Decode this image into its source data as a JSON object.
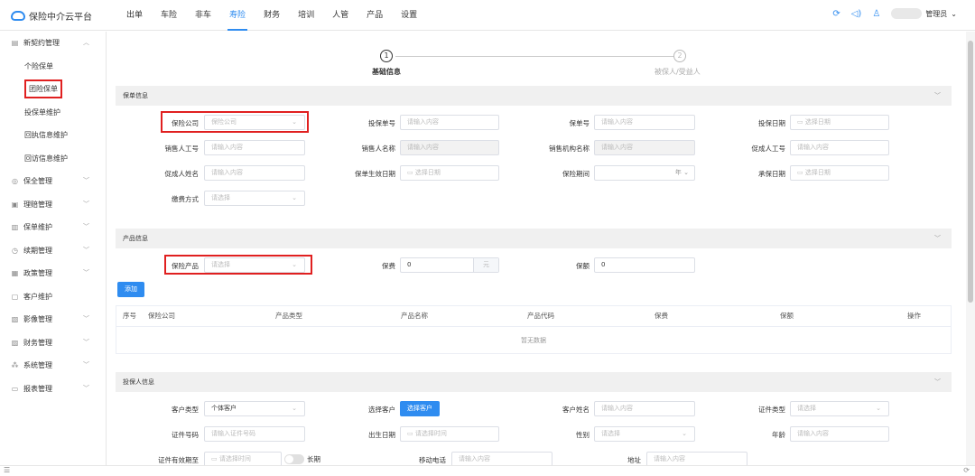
{
  "app": {
    "title": "保险中介云平台",
    "user": "管理员"
  },
  "nav": [
    "出单",
    "车险",
    "非车",
    "寿险",
    "财务",
    "培训",
    "人管",
    "产品",
    "设置"
  ],
  "nav_active": "寿险",
  "sidebar": {
    "groups": [
      {
        "label": "新契约管理",
        "icon": "contract-icon"
      },
      {
        "label": "保全管理",
        "icon": "shield-icon"
      },
      {
        "label": "理赔管理",
        "icon": "claim-icon"
      },
      {
        "label": "保单维护",
        "icon": "policy-icon"
      },
      {
        "label": "续期管理",
        "icon": "clock-icon"
      },
      {
        "label": "政策管理",
        "icon": "policy-rule-icon"
      },
      {
        "label": "客户维护",
        "icon": "customer-icon"
      },
      {
        "label": "影像管理",
        "icon": "image-icon"
      },
      {
        "label": "财务管理",
        "icon": "finance-icon"
      },
      {
        "label": "系统管理",
        "icon": "system-icon"
      },
      {
        "label": "报表管理",
        "icon": "report-icon"
      }
    ],
    "sub_items": [
      "个险保单",
      "团险保单",
      "投保单维护",
      "回执信息维护",
      "回访信息维护"
    ]
  },
  "steps": [
    {
      "num": "1",
      "label": "基础信息"
    },
    {
      "num": "2",
      "label": "被保人/受益人"
    }
  ],
  "sections": {
    "policy": "保单信息",
    "product": "产品信息",
    "applicant": "投保人信息"
  },
  "policy_fields": {
    "insurer": {
      "label": "保险公司",
      "placeholder": "保险公司"
    },
    "app_no": {
      "label": "投保单号",
      "placeholder": "请输入内容"
    },
    "policy_no": {
      "label": "保单号",
      "placeholder": "请输入内容"
    },
    "app_date": {
      "label": "投保日期",
      "placeholder": "选择日期"
    },
    "sales_id": {
      "label": "销售人工号",
      "placeholder": "请输入内容"
    },
    "sales_name": {
      "label": "销售人名称",
      "placeholder": "请输入内容"
    },
    "sales_org": {
      "label": "销售机构名称",
      "placeholder": "请输入内容"
    },
    "promoter_id": {
      "label": "促成人工号",
      "placeholder": "请输入内容"
    },
    "promoter_name": {
      "label": "促成人姓名",
      "placeholder": "请输入内容"
    },
    "effective_date": {
      "label": "保单生效日期",
      "placeholder": "选择日期"
    },
    "period": {
      "label": "保险期间",
      "unit": "年"
    },
    "accept_date": {
      "label": "承保日期",
      "placeholder": "选择日期"
    },
    "pay_method": {
      "label": "缴费方式",
      "placeholder": "请选择"
    }
  },
  "product_fields": {
    "product": {
      "label": "保险产品",
      "placeholder": "请选择"
    },
    "premium": {
      "label": "保费",
      "value": "0",
      "unit": "元"
    },
    "amount": {
      "label": "保额",
      "value": "0"
    },
    "add_button": "添加"
  },
  "table": {
    "columns": [
      "序号",
      "保险公司",
      "产品类型",
      "产品名称",
      "产品代码",
      "保费",
      "保额",
      "操作"
    ],
    "empty": "暂无数据"
  },
  "applicant_fields": {
    "cust_type": {
      "label": "客户类型",
      "value": "个体客户"
    },
    "select_cust": {
      "label": "选择客户",
      "button": "选择客户"
    },
    "cust_name": {
      "label": "客户姓名",
      "placeholder": "请输入内容"
    },
    "id_type": {
      "label": "证件类型",
      "placeholder": "请选择"
    },
    "id_no": {
      "label": "证件号码",
      "placeholder": "请输入证件号码"
    },
    "birth": {
      "label": "出生日期",
      "placeholder": "请选择时间"
    },
    "gender": {
      "label": "性别",
      "placeholder": "请选择"
    },
    "age": {
      "label": "年龄",
      "placeholder": "请输入内容"
    },
    "id_valid": {
      "label": "证件有效期至",
      "placeholder": "请选择时间",
      "toggle_label": "长期"
    },
    "mobile": {
      "label": "移动电话",
      "placeholder": "请输入内容"
    },
    "address": {
      "label": "地址",
      "placeholder": "请输入内容"
    }
  }
}
